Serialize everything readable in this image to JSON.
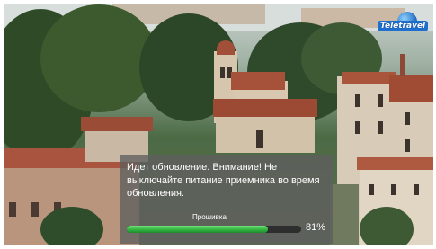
{
  "channel_logo": {
    "name": "Teletravel",
    "icon": "teletravel-logo"
  },
  "update_dialog": {
    "message": "Идет обновление. Внимание! Не выключайте питание приемника во время обновления.",
    "progress_label": "Прошивка",
    "progress_percent": 81,
    "progress_text": "81%",
    "accent_color": "#3cc04a"
  }
}
